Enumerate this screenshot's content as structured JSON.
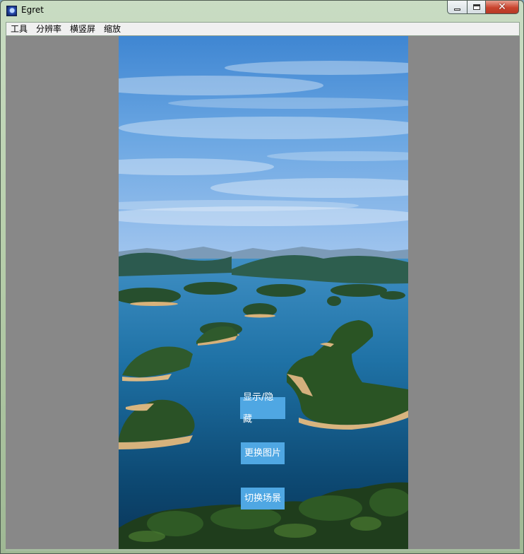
{
  "window": {
    "title": "Egret",
    "icon": "egret-app-icon",
    "controls": {
      "minimize": "minimize-icon",
      "maximize": "maximize-icon",
      "close": "close-icon"
    }
  },
  "menu": {
    "items": [
      {
        "label": "工具"
      },
      {
        "label": "分辨率"
      },
      {
        "label": "横竖屏"
      },
      {
        "label": "缩放"
      }
    ]
  },
  "stage": {
    "background_color": "#888888",
    "image": "lake-islands-landscape",
    "buttons": [
      {
        "label": "显示/隐藏"
      },
      {
        "label": "更换图片"
      },
      {
        "label": "切换场景"
      }
    ],
    "button_color": "#4fa7e3"
  }
}
